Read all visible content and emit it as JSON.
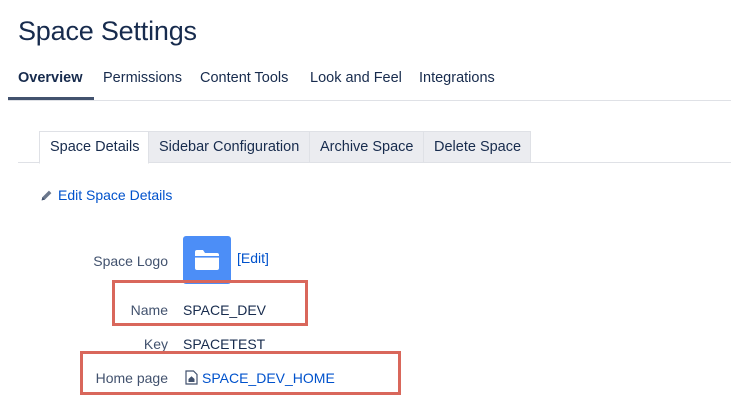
{
  "page": {
    "title": "Space Settings"
  },
  "main_tabs": [
    {
      "label": "Overview",
      "active": true
    },
    {
      "label": "Permissions",
      "active": false
    },
    {
      "label": "Content Tools",
      "active": false
    },
    {
      "label": "Look and Feel",
      "active": false
    },
    {
      "label": "Integrations",
      "active": false
    }
  ],
  "sub_tabs": [
    {
      "label": "Space Details",
      "active": true
    },
    {
      "label": "Sidebar Configuration",
      "active": false
    },
    {
      "label": "Archive Space",
      "active": false
    },
    {
      "label": "Delete Space",
      "active": false
    }
  ],
  "edit_details": {
    "label": "Edit Space Details"
  },
  "details": {
    "logo": {
      "label": "Space Logo",
      "edit_label": "[Edit]"
    },
    "name": {
      "label": "Name",
      "value": "SPACE_DEV"
    },
    "key": {
      "label": "Key",
      "value": "SPACETEST"
    },
    "home_page": {
      "label": "Home page",
      "value": "SPACE_DEV_HOME"
    }
  },
  "colors": {
    "accent": "#0052cc",
    "logo_bg": "#4c8ef7",
    "highlight": "#d9675b",
    "text": "#172b4d"
  },
  "icons": [
    "pencil-icon",
    "folder-icon",
    "home-page-icon"
  ]
}
